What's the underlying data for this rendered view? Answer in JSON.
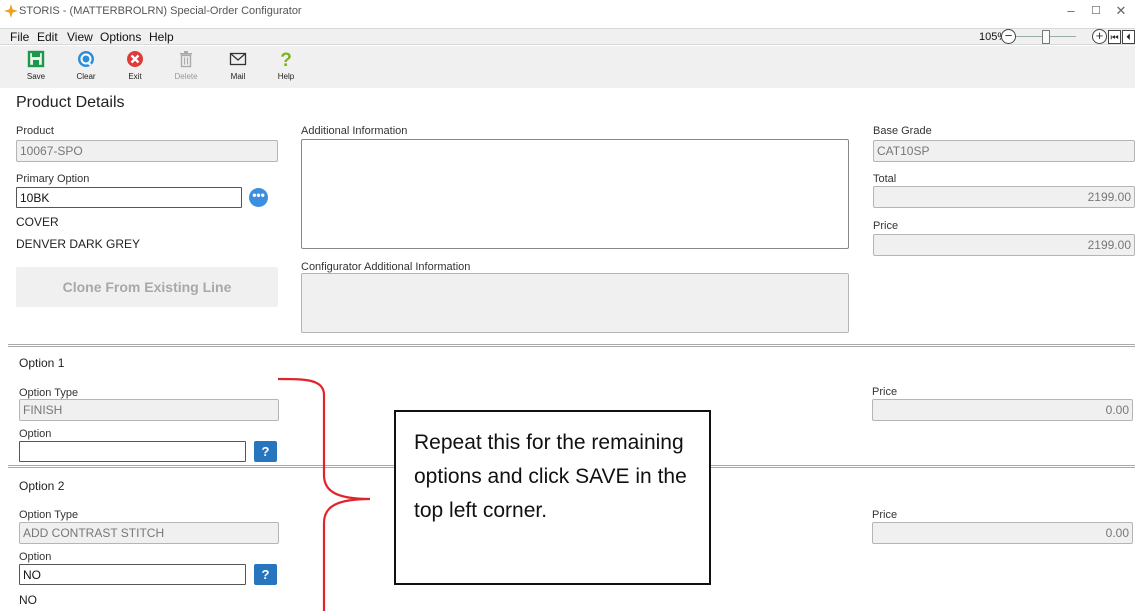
{
  "window": {
    "title": "STORIS - (MATTERBROLRN) Special-Order Configurator",
    "min_symbol": "–",
    "max_symbol": "☐",
    "close_symbol": "✕"
  },
  "menu": [
    "File",
    "Edit",
    "View",
    "Options",
    "Help"
  ],
  "zoom": {
    "level": "105%",
    "minus": "−",
    "plus": "+",
    "nav_first": "⏮",
    "nav_prev": "⏴"
  },
  "toolbar": {
    "save": "Save",
    "clear": "Clear",
    "exit": "Exit",
    "delete": "Delete",
    "mail": "Mail",
    "help": "Help"
  },
  "product_details": {
    "heading": "Product Details",
    "product_label": "Product",
    "product_value": "10067-SPO",
    "primary_option_label": "Primary Option",
    "primary_option_value": "10BK",
    "ellipsis": "•••",
    "cover": "COVER",
    "cover_desc": "DENVER DARK GREY",
    "clone_button": "Clone From Existing Line",
    "additional_info_label": "Additional Information",
    "config_info_label": "Configurator Additional Information",
    "base_grade_label": "Base Grade",
    "base_grade_value": "CAT10SP",
    "total_label": "Total",
    "total_value": "2199.00",
    "price_label": "Price",
    "price_value": "2199.00"
  },
  "options": [
    {
      "heading": "Option 1",
      "type_label": "Option Type",
      "type_value": "FINISH",
      "option_label": "Option",
      "option_value": "",
      "help": "?",
      "price_label": "Price",
      "price_value": "0.00"
    },
    {
      "heading": "Option 2",
      "type_label": "Option Type",
      "type_value": "ADD CONTRAST STITCH",
      "option_label": "Option",
      "option_value": "NO",
      "option_desc": "NO",
      "help": "?",
      "price_label": "Price",
      "price_value": "0.00"
    }
  ],
  "callout": {
    "text": "Repeat this for the remaining options and click SAVE in the top left corner.",
    "bracket_color": "#e0242c"
  },
  "colors": {
    "accent_blue": "#2774bf",
    "save_green": "#1a9a48",
    "exit_red": "#e03a3a",
    "clear_blue": "#2a8fd8",
    "help_green": "#7ab51d"
  }
}
